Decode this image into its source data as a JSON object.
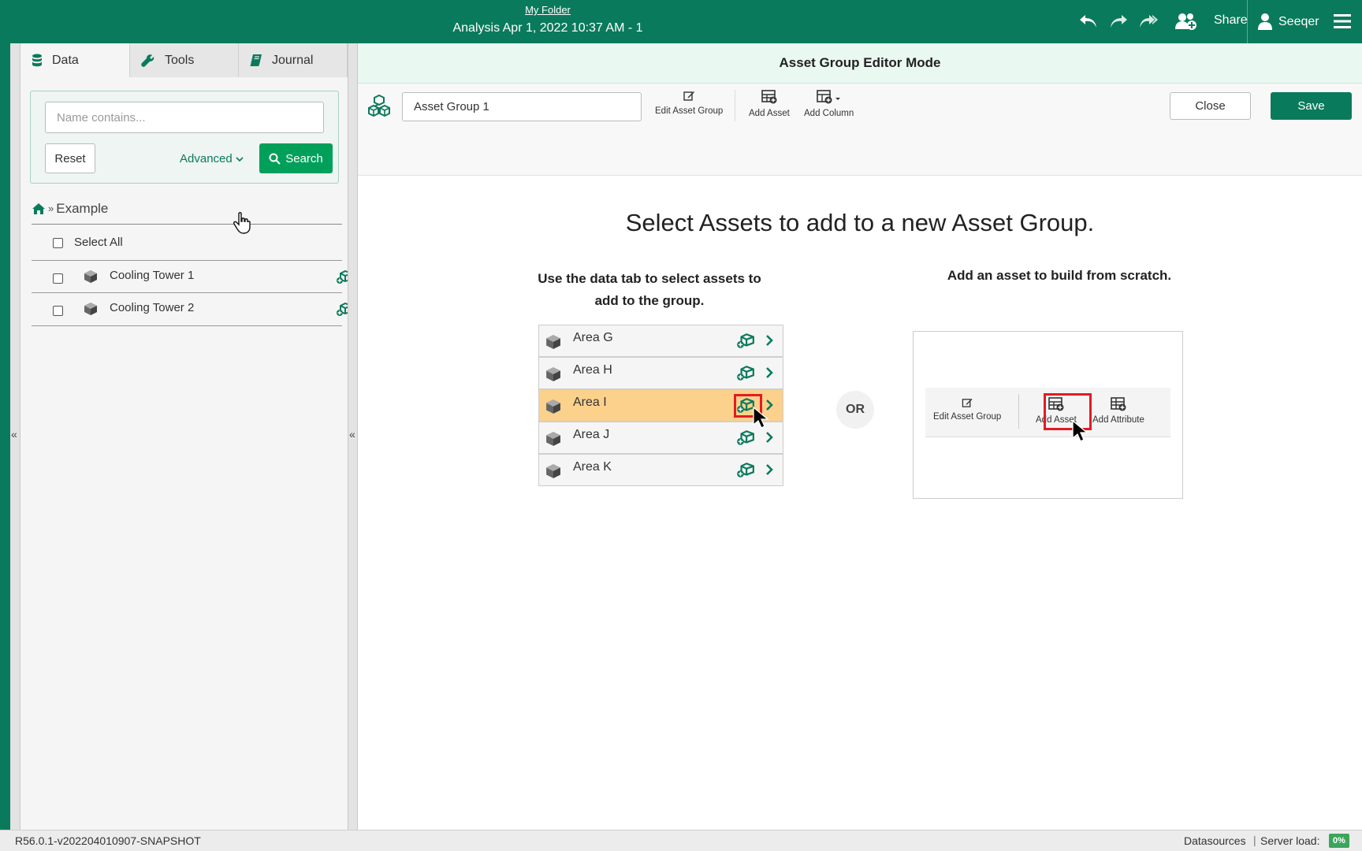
{
  "header": {
    "folder_link": "My Folder",
    "analysis_title": "Analysis Apr 1, 2022 10:37 AM - 1",
    "share_label": "Share",
    "user_label": "Seeqer"
  },
  "left_panel": {
    "tabs": [
      {
        "label": "Data",
        "icon": "database-icon",
        "active": true
      },
      {
        "label": "Tools",
        "icon": "wrench-icon",
        "active": false
      },
      {
        "label": "Journal",
        "icon": "book-icon",
        "active": false
      }
    ],
    "search": {
      "placeholder": "Name contains...",
      "value": "",
      "reset_label": "Reset",
      "advanced_label": "Advanced",
      "search_label": "Search"
    },
    "breadcrumb": {
      "sep": "»",
      "label": "Example"
    },
    "select_all_label": "Select All",
    "items": [
      {
        "label": "Cooling Tower 1"
      },
      {
        "label": "Cooling Tower 2"
      }
    ]
  },
  "main": {
    "mode_title": "Asset Group Editor Mode",
    "toolbar": {
      "group_name": "Asset Group 1",
      "edit_group_label": "Edit Asset Group",
      "add_asset_label": "Add Asset",
      "add_column_label": "Add Column",
      "close_label": "Close",
      "save_label": "Save"
    },
    "heading": "Select Assets to add to a new Asset Group.",
    "left_instruction_line1": "Use the data tab to select assets to",
    "left_instruction_line2": "add to the group.",
    "right_instruction": "Add an asset to build from scratch.",
    "or_label": "OR",
    "example_list": [
      {
        "label": "Area G",
        "highlighted": false
      },
      {
        "label": "Area H",
        "highlighted": false
      },
      {
        "label": "Area I",
        "highlighted": true
      },
      {
        "label": "Area J",
        "highlighted": false
      },
      {
        "label": "Area K",
        "highlighted": false
      }
    ],
    "example_toolbar": {
      "edit_label": "Edit Asset Group",
      "add_asset_label": "Add Asset",
      "add_attribute_label": "Add Attribute"
    }
  },
  "footer": {
    "version": "R56.0.1-v202204010907-SNAPSHOT",
    "datasources_label": "Datasources",
    "pipe": "|",
    "server_load_label": "Server load:",
    "server_load_value": "0%"
  },
  "colors": {
    "brand": "#0a7a5c",
    "search_button": "#00a05a",
    "highlight_row": "#fbd18b",
    "highlight_box": "#e31b23",
    "mode_bar": "#e9f8f1"
  }
}
